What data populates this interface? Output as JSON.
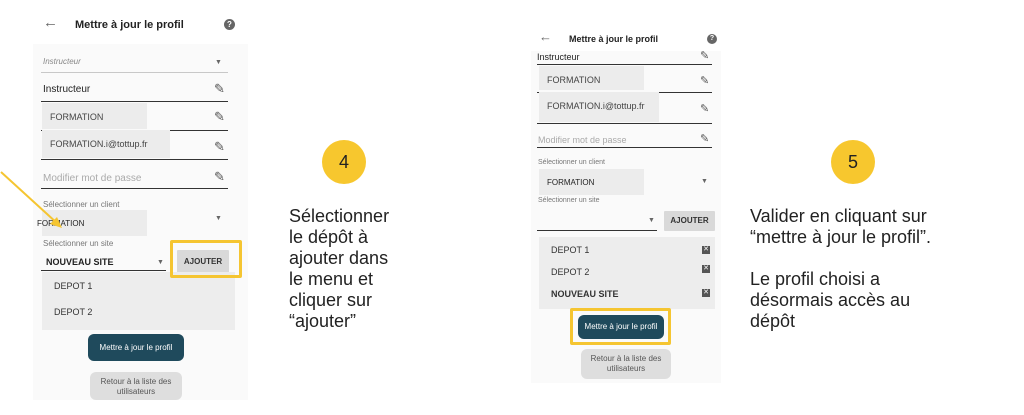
{
  "left_screen": {
    "header": {
      "back": "←",
      "title": "Mettre à jour le profil",
      "help": "?"
    },
    "role_placeholder": "Instructeur",
    "role_value": "Instructeur",
    "name_value": "FORMATION",
    "email_value": "FORMATION.i@tottup.fr",
    "password_placeholder": "Modifier mot de passe",
    "client_label": "Sélectionner un client",
    "client_value": "FORMATION",
    "site_label": "Sélectionner un site",
    "site_value": "NOUVEAU SITE",
    "add_button": "AJOUTER",
    "dropdown_options": [
      "DEPOT 1",
      "DEPOT 2"
    ],
    "update_button": "Mettre à jour le profil",
    "back_button": "Retour à la liste des utilisateurs"
  },
  "step4": {
    "number": "4",
    "lines": [
      "Sélectionner",
      "le dépôt à",
      "ajouter dans",
      "le menu et",
      "cliquer sur",
      "“ajouter”"
    ]
  },
  "right_screen": {
    "header": {
      "back": "←",
      "title": "Mettre à jour le profil",
      "help": "?"
    },
    "role_value": "Instructeur",
    "name_value": "FORMATION",
    "email_value": "FORMATION.i@tottup.fr",
    "password_placeholder": "Modifier mot de passe",
    "client_label": "Sélectionner un client",
    "client_value": "FORMATION",
    "site_label": "Sélectionner un site",
    "add_button": "AJOUTER",
    "sites": [
      "DEPOT 1",
      "DEPOT 2",
      "NOUVEAU SITE"
    ],
    "update_button": "Mettre à jour le profil",
    "back_button_line1": "Retour à la liste des",
    "back_button_line2": "utilisateurs"
  },
  "step5": {
    "number": "5",
    "lines": [
      "Valider en cliquant sur",
      "“mettre à jour le profil”.",
      "",
      "Le profil choisi a",
      "désormais accès au",
      "dépôt"
    ]
  },
  "colors": {
    "accent": "#f5c531",
    "primary_button": "#1f4a5c"
  }
}
